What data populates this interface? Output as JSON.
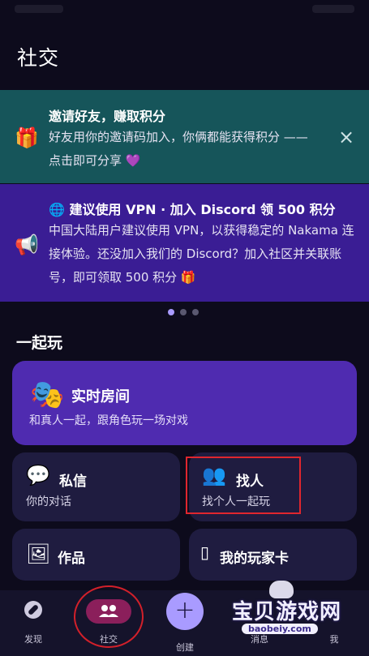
{
  "page": {
    "title": "社交"
  },
  "banners": {
    "invite": {
      "icon": "🎁",
      "title": "邀请好友，赚取积分",
      "text": "好友用你的邀请码加入，你俩都能获得积分 —— 点击即可分享 💜",
      "close_icon": "×"
    },
    "vpn": {
      "icon": "📢",
      "title": "🌐 建议使用 VPN · 加入 Discord 领 500 积分",
      "text": "中国大陆用户建议使用 VPN，以获得稳定的 Nakama 连接体验。还没加入我们的 Discord？加入社区并关联账号，即可领取 500 积分 🎁"
    }
  },
  "carousel": {
    "total": 3,
    "active": 0
  },
  "section": {
    "title": "一起玩"
  },
  "cards": {
    "live_room": {
      "icon": "🎭",
      "title": "实时房间",
      "subtitle": "和真人一起，跟角色玩一场对戏"
    },
    "messages": {
      "icon": "💬",
      "title": "私信",
      "subtitle": "你的对话"
    },
    "find_people": {
      "icon": "👥",
      "title": "找人",
      "subtitle": "找个人一起玩"
    },
    "works": {
      "icon": "🖼",
      "title": "作品"
    },
    "player_card": {
      "icon": "▯",
      "title": "我的玩家卡"
    }
  },
  "nav": {
    "discover": "发现",
    "social": "社交",
    "create": "创建",
    "messages": "消息",
    "me": "我"
  },
  "watermark": {
    "text": "宝贝游戏网",
    "url": "baobeiy.com"
  },
  "colors": {
    "background": "#0d0b1c",
    "invite_banner": "#16555a",
    "vpn_banner": "#3a1d94",
    "live_card": "#4f2bb0",
    "card": "#1f1c40",
    "accent": "#a99bff",
    "social_active": "#8b1f5b"
  }
}
